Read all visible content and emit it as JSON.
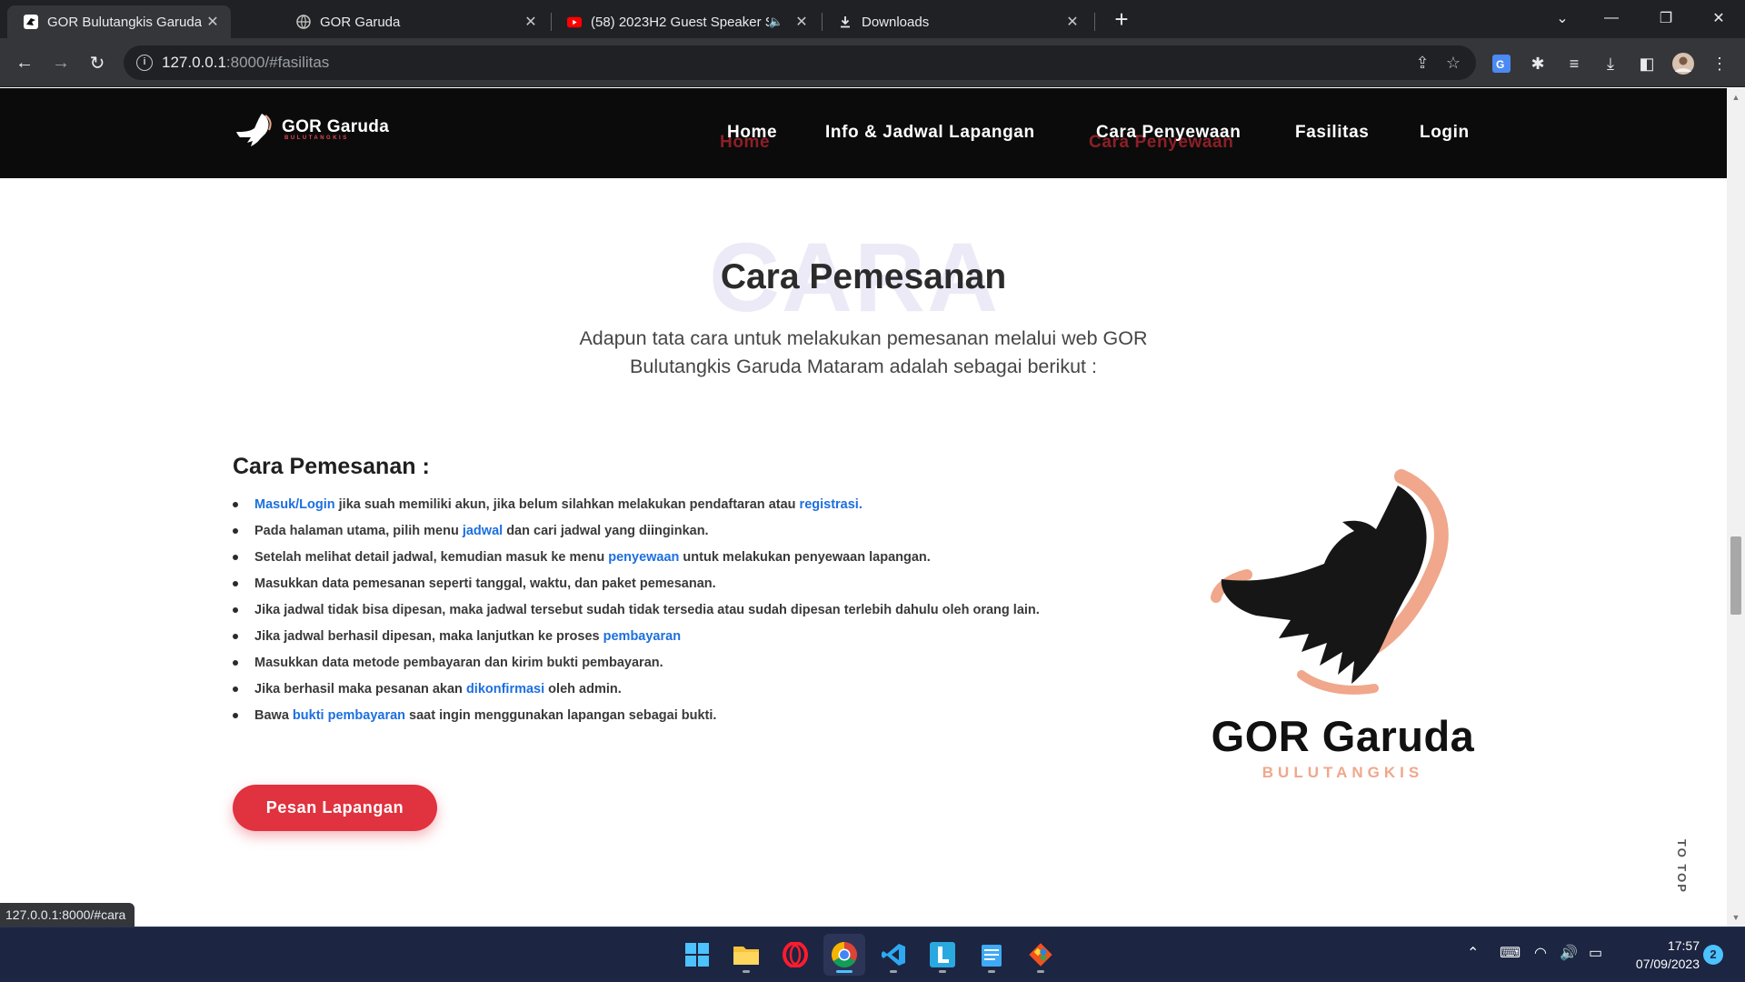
{
  "browser": {
    "tabs": [
      {
        "title": "GOR Bulutangkis Garuda",
        "active": true,
        "favicon": "garuda-favicon"
      },
      {
        "title": "GOR Garuda",
        "active": false,
        "favicon": "globe-icon"
      },
      {
        "title": "(58) 2023H2 Guest Speaker S",
        "active": false,
        "favicon": "youtube-icon",
        "audio": true
      },
      {
        "title": "Downloads",
        "active": false,
        "favicon": "download-icon"
      }
    ],
    "url_host": "127.0.0.1",
    "url_rest": ":8000/#fasilitas",
    "status_url": "127.0.0.1:8000/#cara"
  },
  "site": {
    "logo": {
      "name": "GOR Garuda",
      "tagline": "BULUTANGKIS"
    },
    "nav": [
      {
        "label": "Home",
        "ghost": "Home"
      },
      {
        "label": "Info & Jadwal Lapangan"
      },
      {
        "label": "Cara Penyewaan",
        "ghost": "Cara Penyewaan"
      },
      {
        "label": "Fasilitas"
      },
      {
        "label": "Login"
      }
    ]
  },
  "section": {
    "bg_text": "CARA",
    "title": "Cara Pemesanan",
    "description": "Adapun tata cara untuk melakukan pemesanan melalui web GOR Bulutangkis Garuda Mataram adalah sebagai berikut :",
    "steps_heading": "Cara Pemesanan :",
    "steps": [
      {
        "link_start": "Masuk/Login",
        "text": " jika suah memiliki akun, jika belum silahkan melakukan pendaftaran atau ",
        "link_end": "registrasi."
      },
      {
        "before": "Pada halaman utama, pilih menu ",
        "link": "jadwal",
        "after": " dan cari jadwal yang diinginkan."
      },
      {
        "before": "Setelah melihat detail jadwal, kemudian masuk ke menu ",
        "link": "penyewaan",
        "after": " untuk melakukan penyewaan lapangan."
      },
      {
        "before": "Masukkan data pemesanan seperti tanggal, waktu, dan paket pemesanan.",
        "link": "",
        "after": ""
      },
      {
        "before": "Jika jadwal tidak bisa dipesan, maka jadwal tersebut sudah tidak tersedia atau sudah dipesan terlebih dahulu oleh orang lain.",
        "link": "",
        "after": ""
      },
      {
        "before": "Jika jadwal berhasil dipesan, maka lanjutkan ke proses ",
        "link": "pembayaran",
        "after": ""
      },
      {
        "before": "Masukkan data metode pembayaran dan kirim bukti pembayaran.",
        "link": "",
        "after": ""
      },
      {
        "before": "Jika berhasil maka pesanan akan ",
        "link": "dikonfirmasi",
        "after": " oleh admin."
      },
      {
        "before": "Bawa ",
        "link": "bukti pembayaran",
        "after": " saat ingin menggunakan lapangan sebagai bukti."
      }
    ],
    "cta": "Pesan Lapangan",
    "brand_name": "GOR Garuda",
    "brand_sub": "BULUTANGKIS",
    "to_top": "TO TOP"
  },
  "taskbar": {
    "apps": [
      "windows-start-icon",
      "file-explorer-icon",
      "opera-icon",
      "chrome-icon",
      "vscode-icon",
      "l-app-icon",
      "notepad-icon",
      "git-icon"
    ],
    "time": "17:57",
    "date": "07/09/2023",
    "notifications": "2"
  },
  "colors": {
    "accent": "#e0323f",
    "link": "#1d6fe0",
    "brand_peach": "#f0a78c",
    "header_bg": "#0b0b0b"
  }
}
